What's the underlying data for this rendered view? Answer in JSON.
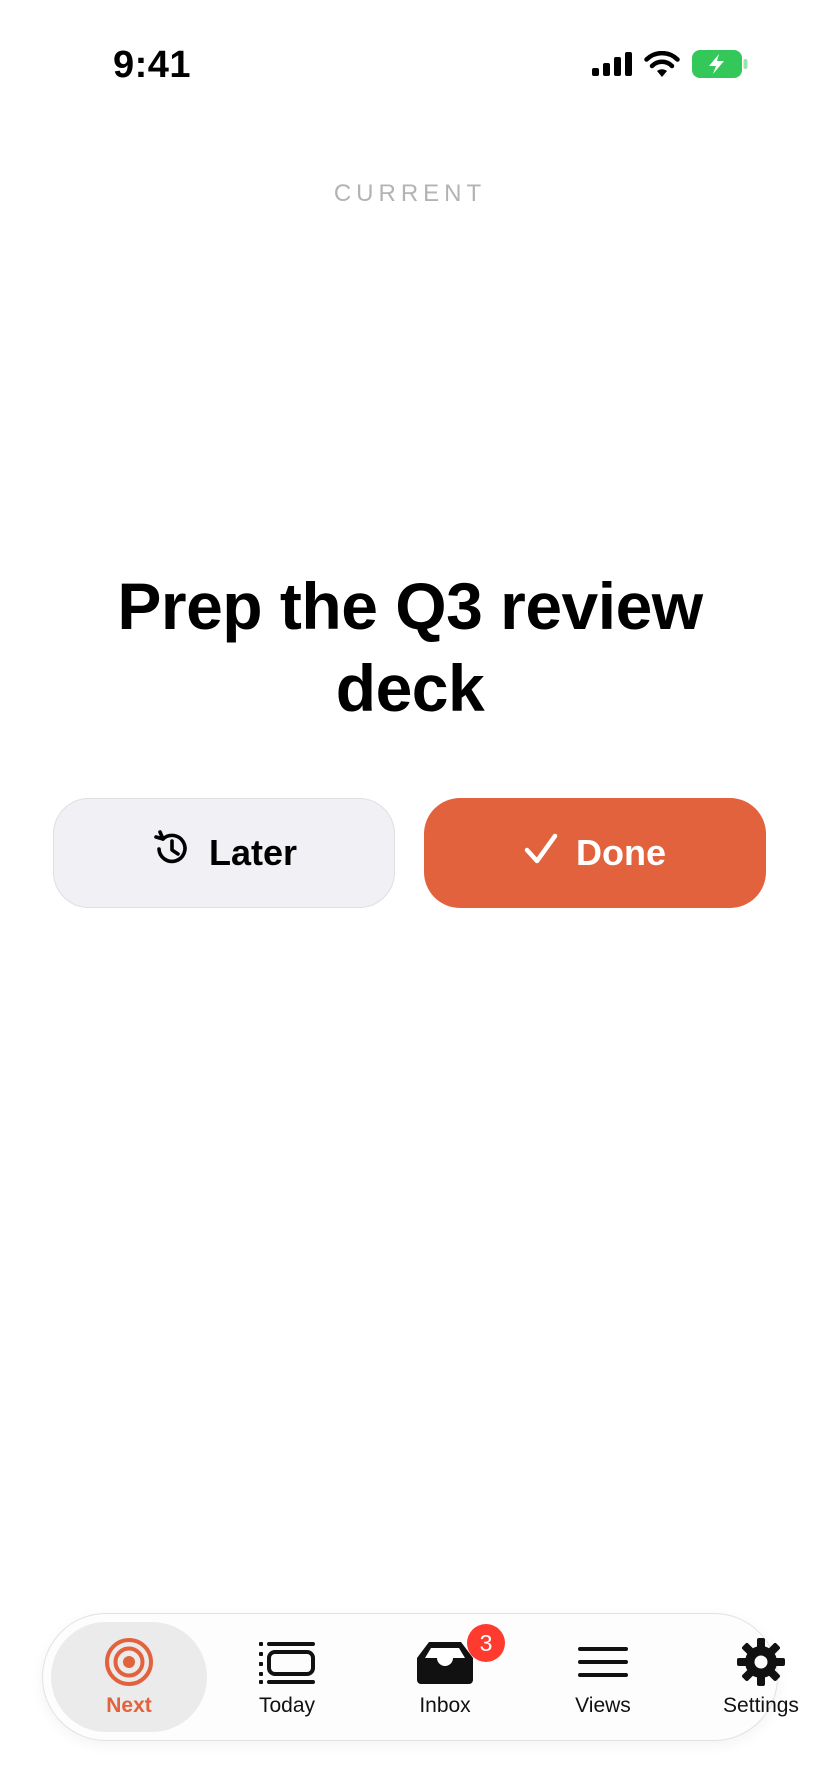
{
  "status_bar": {
    "time": "9:41",
    "icons": [
      "cellular-signal-icon",
      "wifi-icon",
      "battery-charging-icon"
    ],
    "battery_color": "#34c759"
  },
  "header": {
    "section_label": "CURRENT"
  },
  "task": {
    "title": "Prep the Q3 review deck"
  },
  "actions": {
    "later_label": "Later",
    "later_icon": "history-clock-icon",
    "done_label": "Done",
    "done_icon": "checkmark-icon"
  },
  "colors": {
    "accent": "#e1623c",
    "secondary_button_bg": "#f1f1f5",
    "badge": "#ff3b30",
    "section_label": "#b3b3b3"
  },
  "tab_bar": {
    "tabs": [
      {
        "label": "Next",
        "icon": "target-icon",
        "active": true
      },
      {
        "label": "Today",
        "icon": "today-list-icon",
        "active": false
      },
      {
        "label": "Inbox",
        "icon": "inbox-tray-icon",
        "active": false,
        "badge": "3"
      },
      {
        "label": "Views",
        "icon": "lines-icon",
        "active": false
      },
      {
        "label": "Settings",
        "icon": "gear-icon",
        "active": false
      }
    ]
  }
}
